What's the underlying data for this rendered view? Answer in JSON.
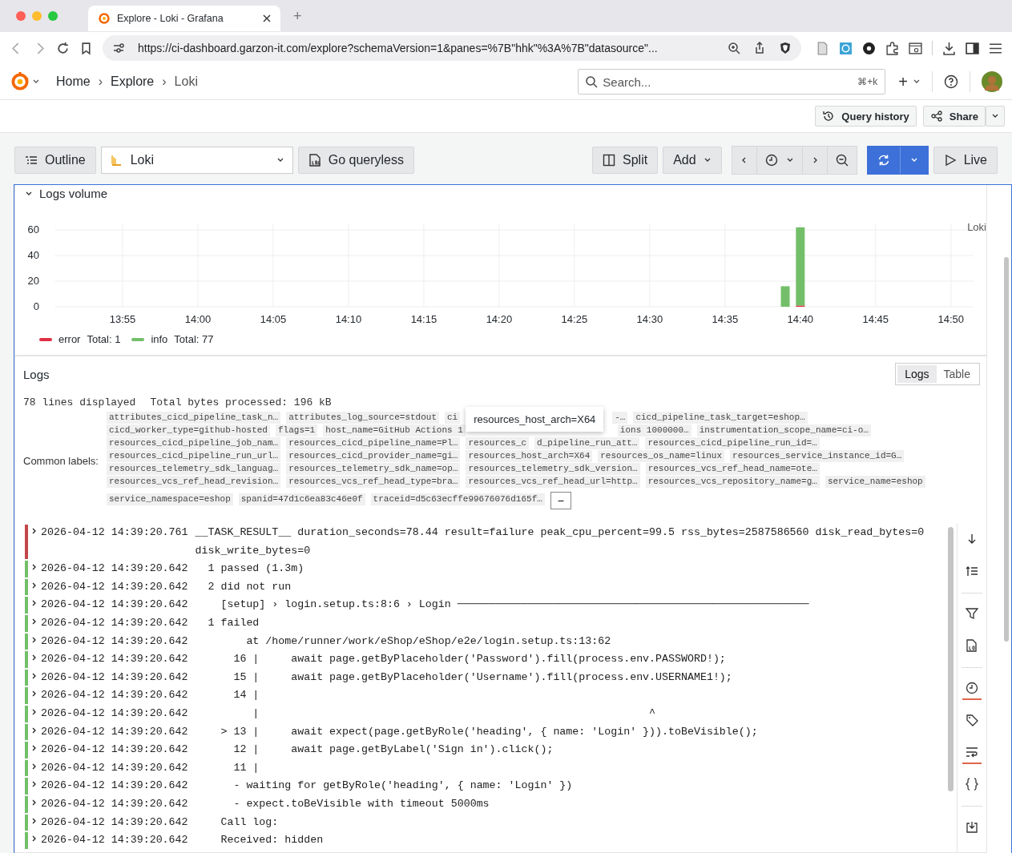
{
  "browser": {
    "tab_title": "Explore - Loki - Grafana",
    "new_tab": "+",
    "url": "https://ci-dashboard.garzon-it.com/explore?schemaVersion=1&panes=%7B\"hhk\"%3A%7B\"datasource\"..."
  },
  "topbar": {
    "breadcrumbs": [
      "Home",
      "Explore",
      "Loki"
    ],
    "separator": "›",
    "search_placeholder": "Search...",
    "search_shortcut": "⌘+k",
    "plus": "+"
  },
  "subbar": {
    "query_history": "Query history",
    "share": "Share"
  },
  "toolbar": {
    "outline": "Outline",
    "datasource": "Loki",
    "go_queryless": "Go queryless",
    "split": "Split",
    "add": "Add",
    "live": "Live"
  },
  "logs_volume": {
    "title": "Logs volume",
    "source": "Loki",
    "chart_data": {
      "type": "bar",
      "stacked": true,
      "grid": true,
      "categories": [
        null,
        null,
        null,
        null,
        "13:55",
        null,
        null,
        null,
        null,
        "14:00",
        null,
        null,
        null,
        null,
        "14:05",
        null,
        null,
        null,
        null,
        "14:10",
        null,
        null,
        null,
        null,
        "14:15",
        null,
        null,
        null,
        null,
        "14:20",
        null,
        null,
        null,
        null,
        "14:25",
        null,
        null,
        null,
        null,
        "14:30",
        null,
        null,
        null,
        null,
        "14:35",
        null,
        null,
        null,
        null,
        "14:40",
        null,
        null,
        null,
        null,
        "14:45",
        null,
        null,
        null,
        null,
        "14:50",
        null
      ],
      "ylim": [
        0,
        65
      ],
      "yticks": [
        0,
        20,
        40,
        60
      ],
      "series": [
        {
          "name": "error",
          "color": "#e02f44",
          "values": [
            null,
            null,
            null,
            null,
            null,
            null,
            null,
            null,
            null,
            null,
            null,
            null,
            null,
            null,
            null,
            null,
            null,
            null,
            null,
            null,
            null,
            null,
            null,
            null,
            null,
            null,
            null,
            null,
            null,
            null,
            null,
            null,
            null,
            null,
            null,
            null,
            null,
            null,
            null,
            null,
            null,
            null,
            null,
            null,
            null,
            null,
            null,
            null,
            0,
            1,
            null,
            null,
            null,
            null,
            null,
            null,
            null,
            null,
            null,
            null,
            null
          ]
        },
        {
          "name": "info",
          "color": "#73bf69",
          "values": [
            null,
            null,
            null,
            null,
            null,
            null,
            null,
            null,
            null,
            null,
            null,
            null,
            null,
            null,
            null,
            null,
            null,
            null,
            null,
            null,
            null,
            null,
            null,
            null,
            null,
            null,
            null,
            null,
            null,
            null,
            null,
            null,
            null,
            null,
            null,
            null,
            null,
            null,
            null,
            null,
            null,
            null,
            null,
            null,
            null,
            null,
            null,
            null,
            16,
            61,
            null,
            null,
            null,
            null,
            null,
            null,
            null,
            null,
            null,
            null,
            null
          ]
        }
      ]
    },
    "totals": [
      "Total: 1",
      "Total: 77"
    ]
  },
  "logs": {
    "title": "Logs",
    "view_tabs": [
      {
        "label": "Logs",
        "selected": true
      },
      {
        "label": "Table",
        "selected": false
      }
    ],
    "lines_displayed": "78 lines displayed",
    "bytes_label": "Total bytes processed: ",
    "bytes_value": "196 kB",
    "common_labels_title": "Common labels:",
    "label_rows": [
      [
        {
          "kind": "chip",
          "text": "attributes_cicd_pipeline_task_n…"
        },
        {
          "kind": "chip",
          "text": "attributes_log_source=stdout"
        },
        {
          "kind": "chip",
          "text": "ci"
        },
        {
          "kind": "tooltip",
          "text": "resources_host_arch=X64"
        },
        {
          "kind": "chip",
          "text": "-…"
        },
        {
          "kind": "chip",
          "text": "cicd_pipeline_task_target=eshop…"
        }
      ],
      [
        {
          "kind": "chip",
          "text": "cicd_worker_type=github-hosted"
        },
        {
          "kind": "chip",
          "text": "flags=1"
        },
        {
          "kind": "chip",
          "text": "host_name=GitHub Actions 1"
        },
        {
          "kind": "covered"
        },
        {
          "kind": "chip",
          "text": "ions 1000000…"
        },
        {
          "kind": "chip",
          "text": "instrumentation_scope_name=ci-o…"
        }
      ],
      [
        {
          "kind": "chip",
          "text": "resources_cicd_pipeline_job_nam…"
        },
        {
          "kind": "chip",
          "text": "resources_cicd_pipeline_name=Pl…"
        },
        {
          "kind": "chip",
          "text": "resources_c"
        },
        {
          "kind": "chip",
          "text": "d_pipeline_run_att…"
        },
        {
          "kind": "chip",
          "text": "resources_cicd_pipeline_run_id=…"
        }
      ],
      [
        {
          "kind": "chip",
          "text": "resources_cicd_pipeline_run_url…"
        },
        {
          "kind": "chip",
          "text": "resources_cicd_provider_name=gi…"
        },
        {
          "kind": "chip",
          "text": "resources_host_arch=X64"
        },
        {
          "kind": "chip",
          "text": "resources_os_name=linux"
        },
        {
          "kind": "chip",
          "text": "resources_service_instance_id=G…"
        }
      ],
      [
        {
          "kind": "chip",
          "text": "resources_telemetry_sdk_languag…"
        },
        {
          "kind": "chip",
          "text": "resources_telemetry_sdk_name=op…"
        },
        {
          "kind": "chip",
          "text": "resources_telemetry_sdk_version…"
        },
        {
          "kind": "chip",
          "text": "resources_vcs_ref_head_name=ote…"
        }
      ],
      [
        {
          "kind": "chip",
          "text": "resources_vcs_ref_head_revision…"
        },
        {
          "kind": "chip",
          "text": "resources_vcs_ref_head_type=bra…"
        },
        {
          "kind": "chip",
          "text": "resources_vcs_ref_head_url=http…"
        },
        {
          "kind": "chip",
          "text": "resources_vcs_repository_name=g…"
        },
        {
          "kind": "chip",
          "text": "service_name=eshop"
        }
      ],
      [
        {
          "kind": "chip",
          "text": "service_namespace=eshop"
        },
        {
          "kind": "chip",
          "text": "spanid=47d1c6ea83c46e0f"
        },
        {
          "kind": "chip",
          "text": "traceid=d5c63ecffe99676076d165f…"
        },
        {
          "kind": "collapse",
          "text": "−"
        }
      ]
    ],
    "rows": [
      {
        "color": "#c4464b",
        "time": "2026-04-12 14:39:20.761",
        "text": "__TASK_RESULT__ duration_seconds=78.44 result=failure peak_cpu_percent=99.5 rss_bytes=2587586560 disk_read_bytes=0 disk_write_bytes=0"
      },
      {
        "color": "#73bf69",
        "time": "2026-04-12 14:39:20.642",
        "text": "  1 passed (1.3m)"
      },
      {
        "color": "#73bf69",
        "time": "2026-04-12 14:39:20.642",
        "text": "  2 did not run"
      },
      {
        "color": "#73bf69",
        "time": "2026-04-12 14:39:20.642",
        "text": "    [setup] › login.setup.ts:8:6 › Login ───────────────────────────────────────────────────────"
      },
      {
        "color": "#73bf69",
        "time": "2026-04-12 14:39:20.642",
        "text": "  1 failed"
      },
      {
        "color": "#73bf69",
        "time": "2026-04-12 14:39:20.642",
        "text": "        at /home/runner/work/eShop/eShop/e2e/login.setup.ts:13:62"
      },
      {
        "color": "#73bf69",
        "time": "2026-04-12 14:39:20.642",
        "text": "      16 |     await page.getByPlaceholder('Password').fill(process.env.PASSWORD!);"
      },
      {
        "color": "#73bf69",
        "time": "2026-04-12 14:39:20.642",
        "text": "      15 |     await page.getByPlaceholder('Username').fill(process.env.USERNAME1!);"
      },
      {
        "color": "#73bf69",
        "time": "2026-04-12 14:39:20.642",
        "text": "      14 |"
      },
      {
        "color": "#73bf69",
        "time": "2026-04-12 14:39:20.642",
        "text": "         |                                                             ^"
      },
      {
        "color": "#73bf69",
        "time": "2026-04-12 14:39:20.642",
        "text": "    > 13 |     await expect(page.getByRole('heading', { name: 'Login' })).toBeVisible();"
      },
      {
        "color": "#73bf69",
        "time": "2026-04-12 14:39:20.642",
        "text": "      12 |     await page.getByLabel('Sign in').click();"
      },
      {
        "color": "#73bf69",
        "time": "2026-04-12 14:39:20.642",
        "text": "      11 |"
      },
      {
        "color": "#73bf69",
        "time": "2026-04-12 14:39:20.642",
        "text": "      - waiting for getByRole('heading', { name: 'Login' })"
      },
      {
        "color": "#73bf69",
        "time": "2026-04-12 14:39:20.642",
        "text": "      - expect.toBeVisible with timeout 5000ms"
      },
      {
        "color": "#73bf69",
        "time": "2026-04-12 14:39:20.642",
        "text": "    Call log:"
      },
      {
        "color": "#73bf69",
        "time": "2026-04-12 14:39:20.642",
        "text": "    Received: hidden"
      }
    ],
    "tools": [
      {
        "kind": "scroll-bottom",
        "on": false
      },
      {
        "kind": "sort",
        "on": false
      },
      {
        "kind": "divider"
      },
      {
        "kind": "filter",
        "on": false
      },
      {
        "kind": "log",
        "on": false
      },
      {
        "kind": "divider"
      },
      {
        "kind": "clock",
        "on": true
      },
      {
        "kind": "tag",
        "on": false
      },
      {
        "kind": "wrap",
        "on": true
      },
      {
        "kind": "braces",
        "on": false
      },
      {
        "kind": "divider"
      },
      {
        "kind": "download",
        "on": false
      }
    ]
  }
}
